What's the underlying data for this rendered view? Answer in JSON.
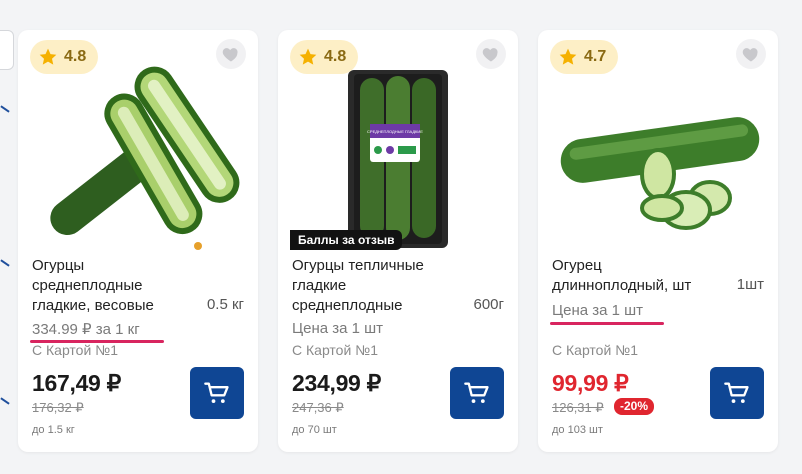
{
  "colors": {
    "accent_blue": "#0f4694",
    "rating_bg": "#fdefc6",
    "star": "#f5b100",
    "sale_red": "#e0262f",
    "annotation_pink": "#d8255f"
  },
  "icons": {
    "rating": "star-icon",
    "favorite": "heart-icon",
    "cart": "cart-icon"
  },
  "products": [
    {
      "rating": "4.8",
      "title": "Огурцы среднеплодные гладкие, весовые",
      "unit": "0.5 кг",
      "price_for": "334.99 ₽ за 1 кг",
      "card_note": "С Картой №1",
      "price": "167,49 ₽",
      "old_price": "176,32 ₽",
      "stock": "до 1.5 кг"
    },
    {
      "rating": "4.8",
      "bonus_tag": "Баллы за отзыв",
      "package_label": "СРЕДНЕПЛОДНЫЕ ГЛАДКИЕ",
      "title": "Огурцы тепличные гладкие среднеплодные",
      "unit": "600г",
      "price_for": "Цена за 1 шт",
      "card_note": "С Картой №1",
      "price": "234,99 ₽",
      "old_price": "247,36 ₽",
      "stock": "до 70 шт"
    },
    {
      "rating": "4.7",
      "title": "Огурец длинноплодный, шт",
      "unit": "1шт",
      "price_for": "Цена за 1 шт",
      "card_note": "С Картой №1",
      "price": "99,99 ₽",
      "old_price": "126,31 ₽",
      "discount": "-20%",
      "stock": "до 103 шт"
    }
  ]
}
